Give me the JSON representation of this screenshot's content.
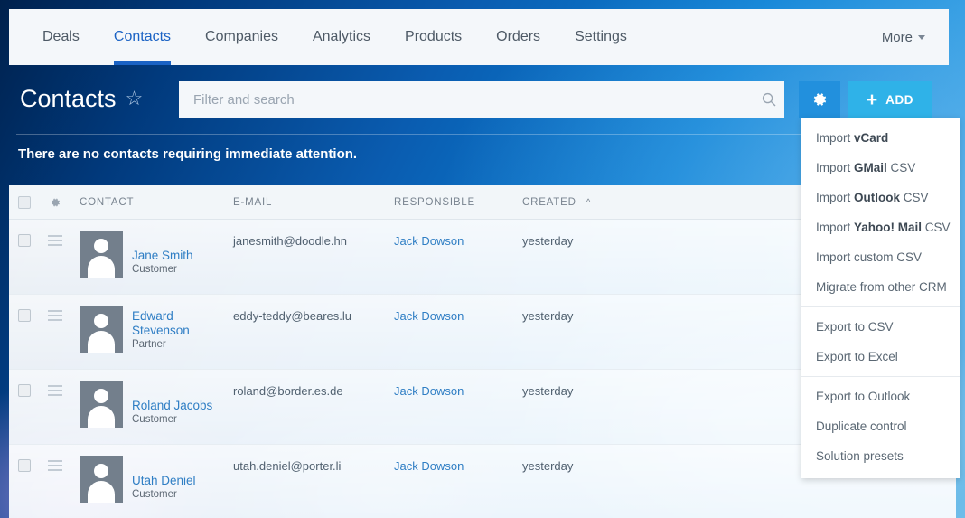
{
  "nav": {
    "items": [
      {
        "label": "Deals",
        "active": false
      },
      {
        "label": "Contacts",
        "active": true
      },
      {
        "label": "Companies",
        "active": false
      },
      {
        "label": "Analytics",
        "active": false
      },
      {
        "label": "Products",
        "active": false
      },
      {
        "label": "Orders",
        "active": false
      },
      {
        "label": "Settings",
        "active": false
      }
    ],
    "more_label": "More"
  },
  "header": {
    "title": "Contacts",
    "star_icon": "star-outline-icon",
    "search": {
      "placeholder": "Filter and search",
      "value": "",
      "icon": "search-icon"
    },
    "gear_button_icon": "gear-icon",
    "add_button": {
      "plus": "+",
      "label": "ADD"
    }
  },
  "notice": {
    "text": "There are no contacts requiring immediate attention."
  },
  "grid": {
    "columns": {
      "contact": "CONTACT",
      "email": "E-MAIL",
      "responsible": "RESPONSIBLE",
      "created": "CREATED",
      "sort_caret": "^",
      "settings_icon": "gear-icon",
      "select_all_icon": "checkbox-icon"
    },
    "rows": [
      {
        "name": "Jane Smith",
        "role": "Customer",
        "email": "janesmith@doodle.hn",
        "responsible": "Jack Dowson",
        "created": "yesterday"
      },
      {
        "name": "Edward Stevenson",
        "role": "Partner",
        "email": "eddy-teddy@beares.lu",
        "responsible": "Jack Dowson",
        "created": "yesterday"
      },
      {
        "name": "Roland Jacobs",
        "role": "Customer",
        "email": "roland@border.es.de",
        "responsible": "Jack Dowson",
        "created": "yesterday"
      },
      {
        "name": "Utah Deniel",
        "role": "Customer",
        "email": "utah.deniel@porter.li",
        "responsible": "Jack Dowson",
        "created": "yesterday"
      }
    ]
  },
  "dropdown": {
    "groups": [
      {
        "items": [
          {
            "pre": "Import ",
            "strong": "vCard",
            "post": ""
          },
          {
            "pre": "Import ",
            "strong": "GMail",
            "post": " CSV"
          },
          {
            "pre": "Import ",
            "strong": "Outlook",
            "post": " CSV"
          },
          {
            "pre": "Import ",
            "strong": "Yahoo! Mail",
            "post": " CSV"
          },
          {
            "pre": "Import custom CSV",
            "strong": "",
            "post": ""
          },
          {
            "pre": "Migrate from other CRM",
            "strong": "",
            "post": ""
          }
        ]
      },
      {
        "items": [
          {
            "pre": "Export to CSV",
            "strong": "",
            "post": ""
          },
          {
            "pre": "Export to Excel",
            "strong": "",
            "post": ""
          }
        ]
      },
      {
        "items": [
          {
            "pre": "Export to Outlook",
            "strong": "",
            "post": ""
          },
          {
            "pre": "Duplicate control",
            "strong": "",
            "post": ""
          },
          {
            "pre": "Solution presets",
            "strong": "",
            "post": ""
          }
        ]
      }
    ]
  },
  "colors": {
    "accent_blue": "#1a62c4",
    "link_blue": "#2f7ec4",
    "add_button": "#2fb2e8",
    "gear_button": "#2290dd",
    "nav_bg": "#f4f7fa"
  }
}
